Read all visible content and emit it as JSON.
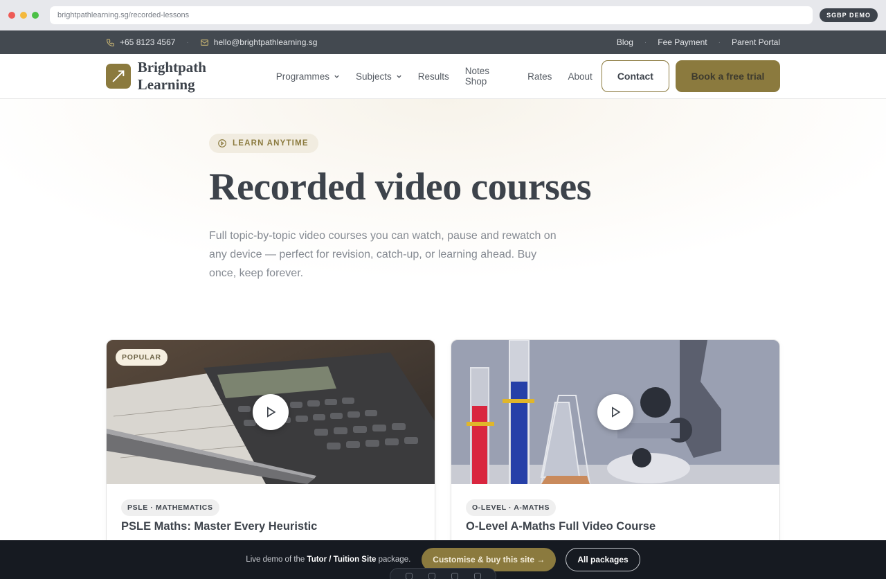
{
  "browser": {
    "url": "brightpathlearning.sg/recorded-lessons",
    "demo_chip": "SGBP DEMO"
  },
  "topbar": {
    "phone": "+65 8123 4567",
    "email": "hello@brightpathlearning.sg",
    "links": [
      "Blog",
      "Fee Payment",
      "Parent Portal"
    ]
  },
  "nav": {
    "brand": "Brightpath Learning",
    "menu": [
      "Programmes",
      "Subjects",
      "Results",
      "Notes Shop",
      "Rates",
      "About"
    ],
    "contact": "Contact",
    "trial": "Book a free trial"
  },
  "hero": {
    "pill": "LEARN ANYTIME",
    "title": "Recorded video courses",
    "description": "Full topic-by-topic video courses you can watch, pause and rewatch on any device — perfect for revision, catch-up, or learning ahead. Buy once, keep forever."
  },
  "cards": [
    {
      "badge": "POPULAR",
      "tag": "PSLE · MATHEMATICS",
      "title": "PSLE Maths: Master Every Heuristic"
    },
    {
      "tag": "O-LEVEL · A-MATHS",
      "title": "O-Level A-Maths Full Video Course"
    }
  ],
  "bottombar": {
    "text_prefix": "Live demo of the",
    "package": "Tutor / Tuition Site",
    "text_suffix": "package.",
    "buy": "Customise & buy this site →",
    "all": "All packages"
  },
  "colors": {
    "accent": "#8b7a3e",
    "dark": "#3d434b",
    "topbar": "#434950",
    "bottombar": "#161a21"
  }
}
